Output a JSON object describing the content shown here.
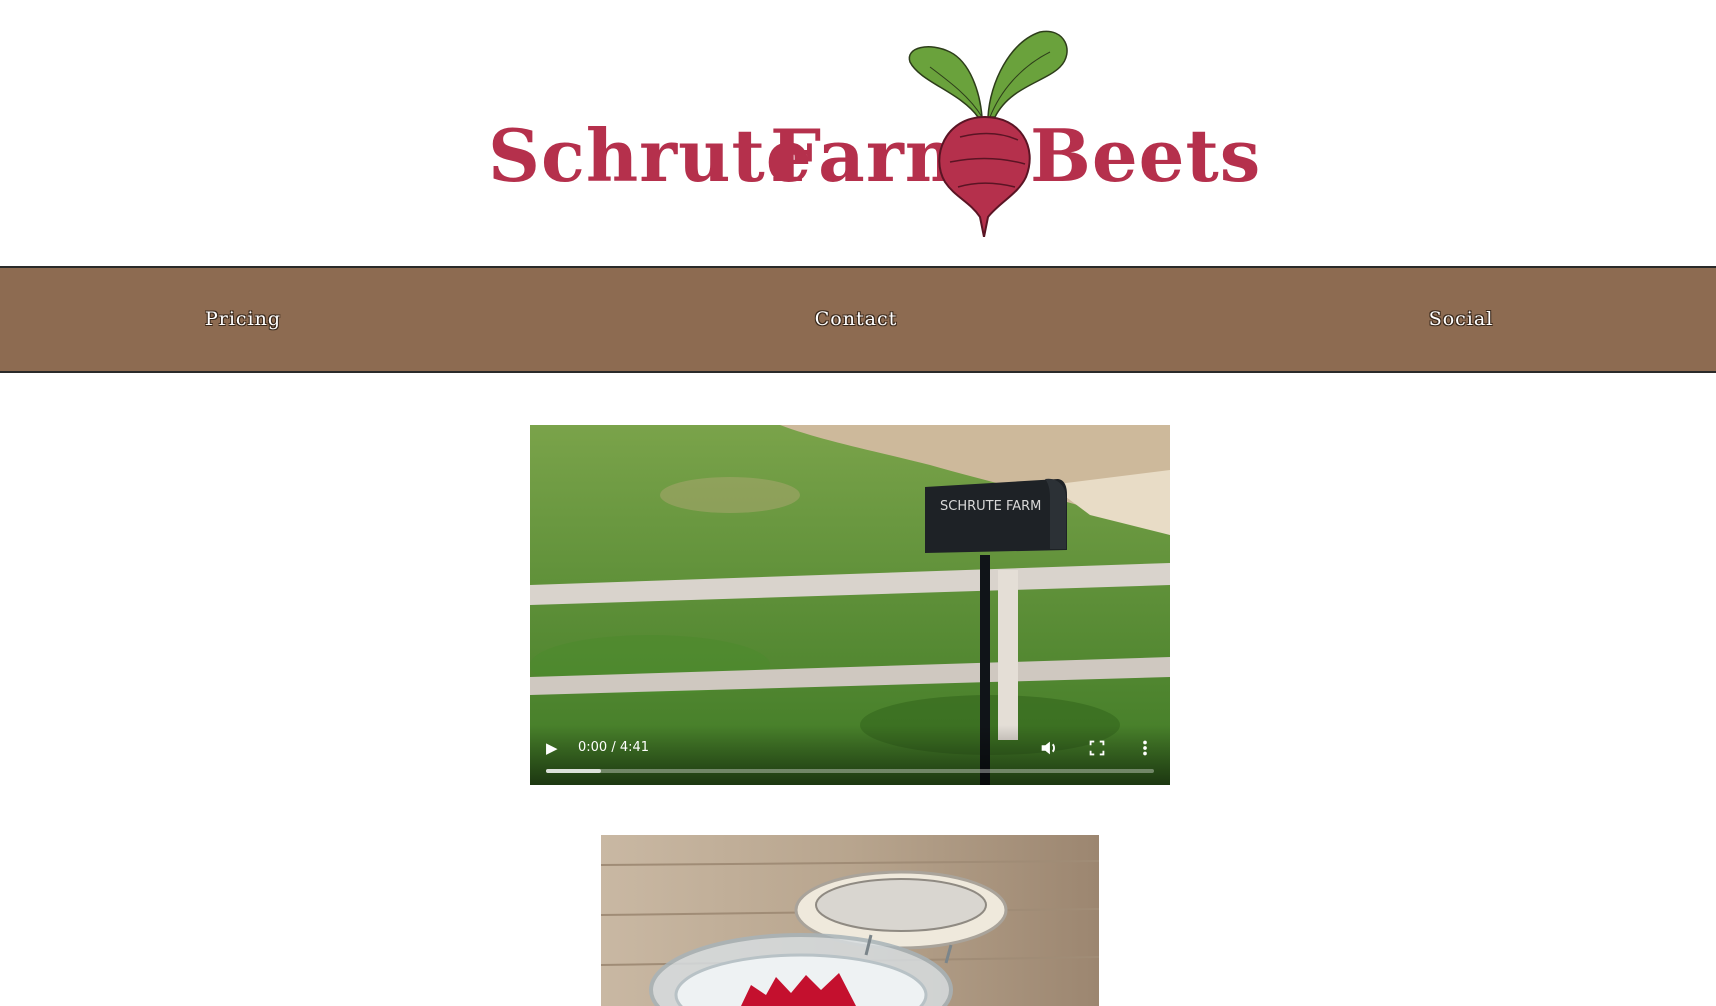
{
  "header": {
    "logo_words": [
      "Schrute",
      "Farm",
      "Beets"
    ],
    "logo_icon": "beet-icon",
    "brand_color": "#b5304c",
    "leaf_color": "#6aa23c"
  },
  "nav": {
    "background": "#8d6b51",
    "items": [
      {
        "label": "Pricing"
      },
      {
        "label": "Contact"
      },
      {
        "label": "Social"
      }
    ]
  },
  "video": {
    "sign_text": "SCHRUTE FARM",
    "time_display": "0:00 / 4:41",
    "buffered_fraction": 0.09,
    "play_icon": "play-icon",
    "volume_icon": "volume-icon",
    "fullscreen_icon": "fullscreen-icon",
    "more_icon": "more-vertical-icon"
  },
  "photo": {
    "subject": "jar-of-beets-image"
  }
}
